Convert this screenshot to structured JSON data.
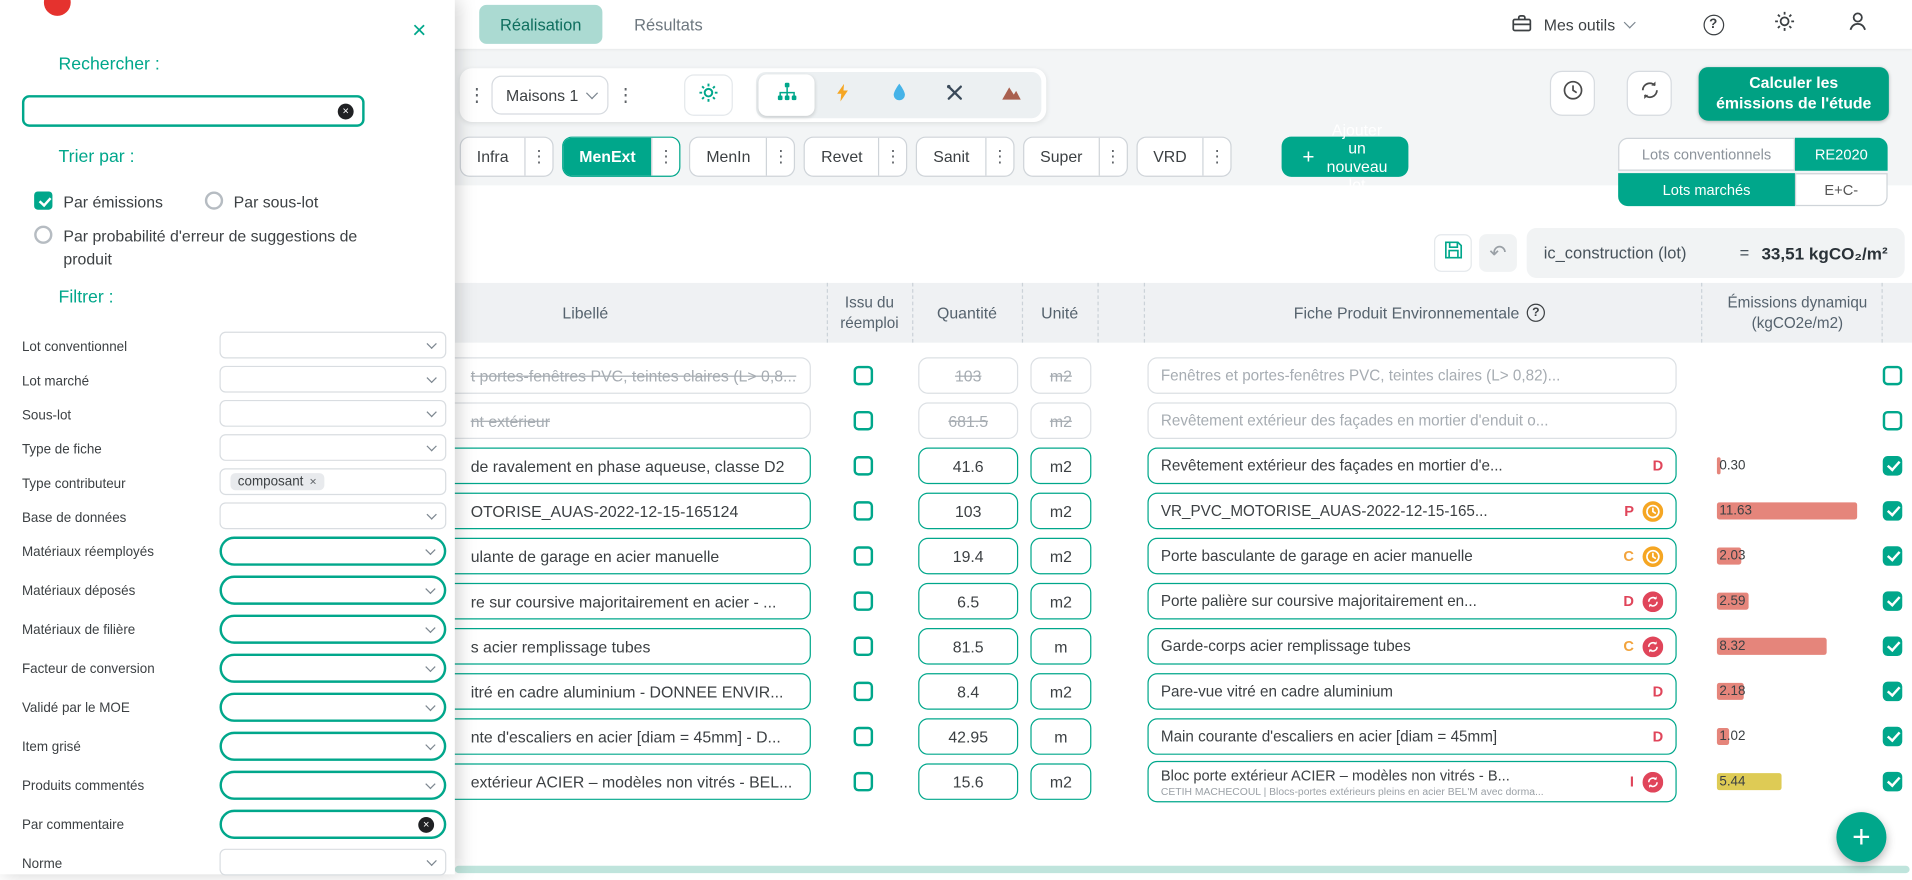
{
  "colors": {
    "accent": "#00A78B",
    "accent_dark": "#00A183",
    "tab_bg": "#ABDAD2",
    "red": "#E0455A",
    "orange": "#F2A33C",
    "bar_salmon": "#E5857B",
    "bar_yellow": "#DECB55"
  },
  "icons": {
    "close": "×",
    "kebab": "⋮",
    "plus": "+",
    "clear": "×",
    "chip_remove": "×",
    "help": "?",
    "undo": "↶"
  },
  "topbar": {
    "tabs": [
      {
        "label": "Réalisation",
        "active": true
      },
      {
        "label": "Résultats",
        "active": false
      }
    ],
    "tools_label": "Mes outils"
  },
  "drawer": {
    "search_label": "Rechercher :",
    "search_value": "",
    "sort_label": "Trier par :",
    "sort_options": [
      {
        "label": "Par émissions",
        "checked": true
      },
      {
        "label": "Par sous-lot",
        "checked": false
      },
      {
        "label": "Par probabilité d'erreur de suggestions de produit",
        "checked": false
      }
    ],
    "filter_label": "Filtrer :",
    "filters": [
      {
        "label": "Lot conventionnel",
        "type": "select",
        "accent": false
      },
      {
        "label": "Lot marché",
        "type": "select",
        "accent": false
      },
      {
        "label": "Sous-lot",
        "type": "select",
        "accent": false
      },
      {
        "label": "Type de fiche",
        "type": "select",
        "accent": false
      },
      {
        "label": "Type contributeur",
        "type": "chips",
        "chip": "composant",
        "accent": false
      },
      {
        "label": "Base de données",
        "type": "select",
        "accent": false
      },
      {
        "label": "Matériaux réemployés",
        "type": "select",
        "accent": true
      },
      {
        "label": "Matériaux déposés",
        "type": "select",
        "accent": true
      },
      {
        "label": "Matériaux de filière",
        "type": "select",
        "accent": true
      },
      {
        "label": "Facteur de conversion",
        "type": "select",
        "accent": true
      },
      {
        "label": "Validé par le MOE",
        "type": "select",
        "accent": true
      },
      {
        "label": "Item grisé",
        "type": "select",
        "accent": true
      },
      {
        "label": "Produits commentés",
        "type": "select",
        "accent": true
      },
      {
        "label": "Par commentaire",
        "type": "clearinput",
        "accent": true
      },
      {
        "label": "Norme",
        "type": "select",
        "accent": false
      }
    ]
  },
  "toolbar": {
    "variant": "Maisons 1",
    "calc_button": "Calculer les émissions de l'étude"
  },
  "lots": {
    "items": [
      {
        "label": "Infra",
        "active": false
      },
      {
        "label": "MenExt",
        "active": true
      },
      {
        "label": "MenIn",
        "active": false
      },
      {
        "label": "Revet",
        "active": false
      },
      {
        "label": "Sanit",
        "active": false
      },
      {
        "label": "Super",
        "active": false
      },
      {
        "label": "VRD",
        "active": false
      }
    ],
    "add_label": "Ajouter un nouveau lot",
    "toggles": [
      {
        "label": "Lots conventionnels",
        "active": false
      },
      {
        "label": "RE2020",
        "active": true
      },
      {
        "label": "Lots marchés",
        "active": true
      },
      {
        "label": "E+C-",
        "active": false
      }
    ]
  },
  "summary": {
    "metric": "ic_construction (lot)",
    "equals": "=",
    "value": "33,51 kgCO₂/m²"
  },
  "table": {
    "headers": {
      "libelle": "Libellé",
      "issu": "Issu du réemploi",
      "quantite": "Quantité",
      "unite": "Unité",
      "fpe": "Fiche Produit Environnementale",
      "emissions_line1": "Émissions dynamiqu",
      "emissions_line2": "(kgCO2e/m2)"
    },
    "rows": [
      {
        "libelle": "t portes-fenêtres PVC, teintes claires (L> 0,8...",
        "greyed": true,
        "quantite": "103",
        "unite": "m2",
        "fpe": "Fenêtres et portes-fenêtres PVC, teintes claires (L> 0,82)...",
        "emission": "",
        "bar": 0,
        "selected": false
      },
      {
        "libelle": "nt extérieur",
        "greyed": true,
        "quantite": "681.5",
        "unite": "m2",
        "fpe": "Revêtement extérieur des façades en mortier d'enduit o...",
        "emission": "",
        "bar": 0,
        "selected": false
      },
      {
        "libelle": "de ravalement en phase aqueuse, classe D2",
        "greyed": false,
        "quantite": "41.6",
        "unite": "m2",
        "fpe": "Revêtement extérieur des façades en mortier d'e...",
        "badge": "D",
        "badge_color": "#E0455A",
        "emission": "0.30",
        "bar": 3,
        "bar_color": "#E5857B",
        "selected": true
      },
      {
        "libelle": "OTORISE_AUAS-2022-12-15-165124",
        "greyed": false,
        "quantite": "103",
        "unite": "m2",
        "fpe": "VR_PVC_MOTORISE_AUAS-2022-12-15-165...",
        "badge": "P",
        "badge_color": "#E0455A",
        "icon": "clock",
        "emission": "11.63",
        "bar": 115,
        "bar_color": "#E5857B",
        "selected": true
      },
      {
        "libelle": "ulante de garage en acier manuelle",
        "greyed": false,
        "quantite": "19.4",
        "unite": "m2",
        "fpe": "Porte basculante de garage en acier manuelle",
        "badge": "C",
        "badge_color": "#F2A33C",
        "icon": "clock",
        "emission": "2.03",
        "bar": 20,
        "bar_color": "#E5857B",
        "selected": true
      },
      {
        "libelle": "re sur coursive majoritairement en acier - ...",
        "greyed": false,
        "quantite": "6.5",
        "unite": "m2",
        "fpe": "Porte palière sur coursive majoritairement en...",
        "badge": "D",
        "badge_color": "#E0455A",
        "icon": "refresh",
        "emission": "2.59",
        "bar": 26,
        "bar_color": "#E5857B",
        "selected": true
      },
      {
        "libelle": "s acier remplissage tubes",
        "greyed": false,
        "quantite": "81.5",
        "unite": "m",
        "fpe": "Garde-corps acier remplissage tubes",
        "badge": "C",
        "badge_color": "#F2A33C",
        "icon": "refresh",
        "emission": "8.32",
        "bar": 90,
        "bar_color": "#E5857B",
        "selected": true
      },
      {
        "libelle": "itré en cadre aluminium - DONNEE ENVIR...",
        "greyed": false,
        "quantite": "8.4",
        "unite": "m2",
        "fpe": "Pare-vue vitré en cadre aluminium",
        "badge": "D",
        "badge_color": "#E0455A",
        "emission": "2.18",
        "bar": 22,
        "bar_color": "#E5857B",
        "selected": true
      },
      {
        "libelle": "nte d'escaliers en acier [diam = 45mm] - D...",
        "greyed": false,
        "quantite": "42.95",
        "unite": "m",
        "fpe": "Main courante d'escaliers en acier  [diam = 45mm]",
        "badge": "D",
        "badge_color": "#E0455A",
        "emission": "1.02",
        "bar": 10,
        "bar_color": "#E5857B",
        "selected": true
      },
      {
        "libelle": "extérieur ACIER – modèles non vitrés - BEL...",
        "greyed": false,
        "quantite": "15.6",
        "unite": "m2",
        "fpe": "Bloc porte extérieur ACIER – modèles non vitrés - B...",
        "fpe_sub": "CETIH MACHECOUL | Blocs-portes extérieurs pleins en acier BEL'M avec dorma...",
        "badge": "I",
        "badge_color": "#E0455A",
        "icon": "refresh",
        "emission": "5.44",
        "bar": 53,
        "bar_color": "#DECB55",
        "selected": true
      }
    ]
  },
  "fab": {
    "icon": "+"
  }
}
